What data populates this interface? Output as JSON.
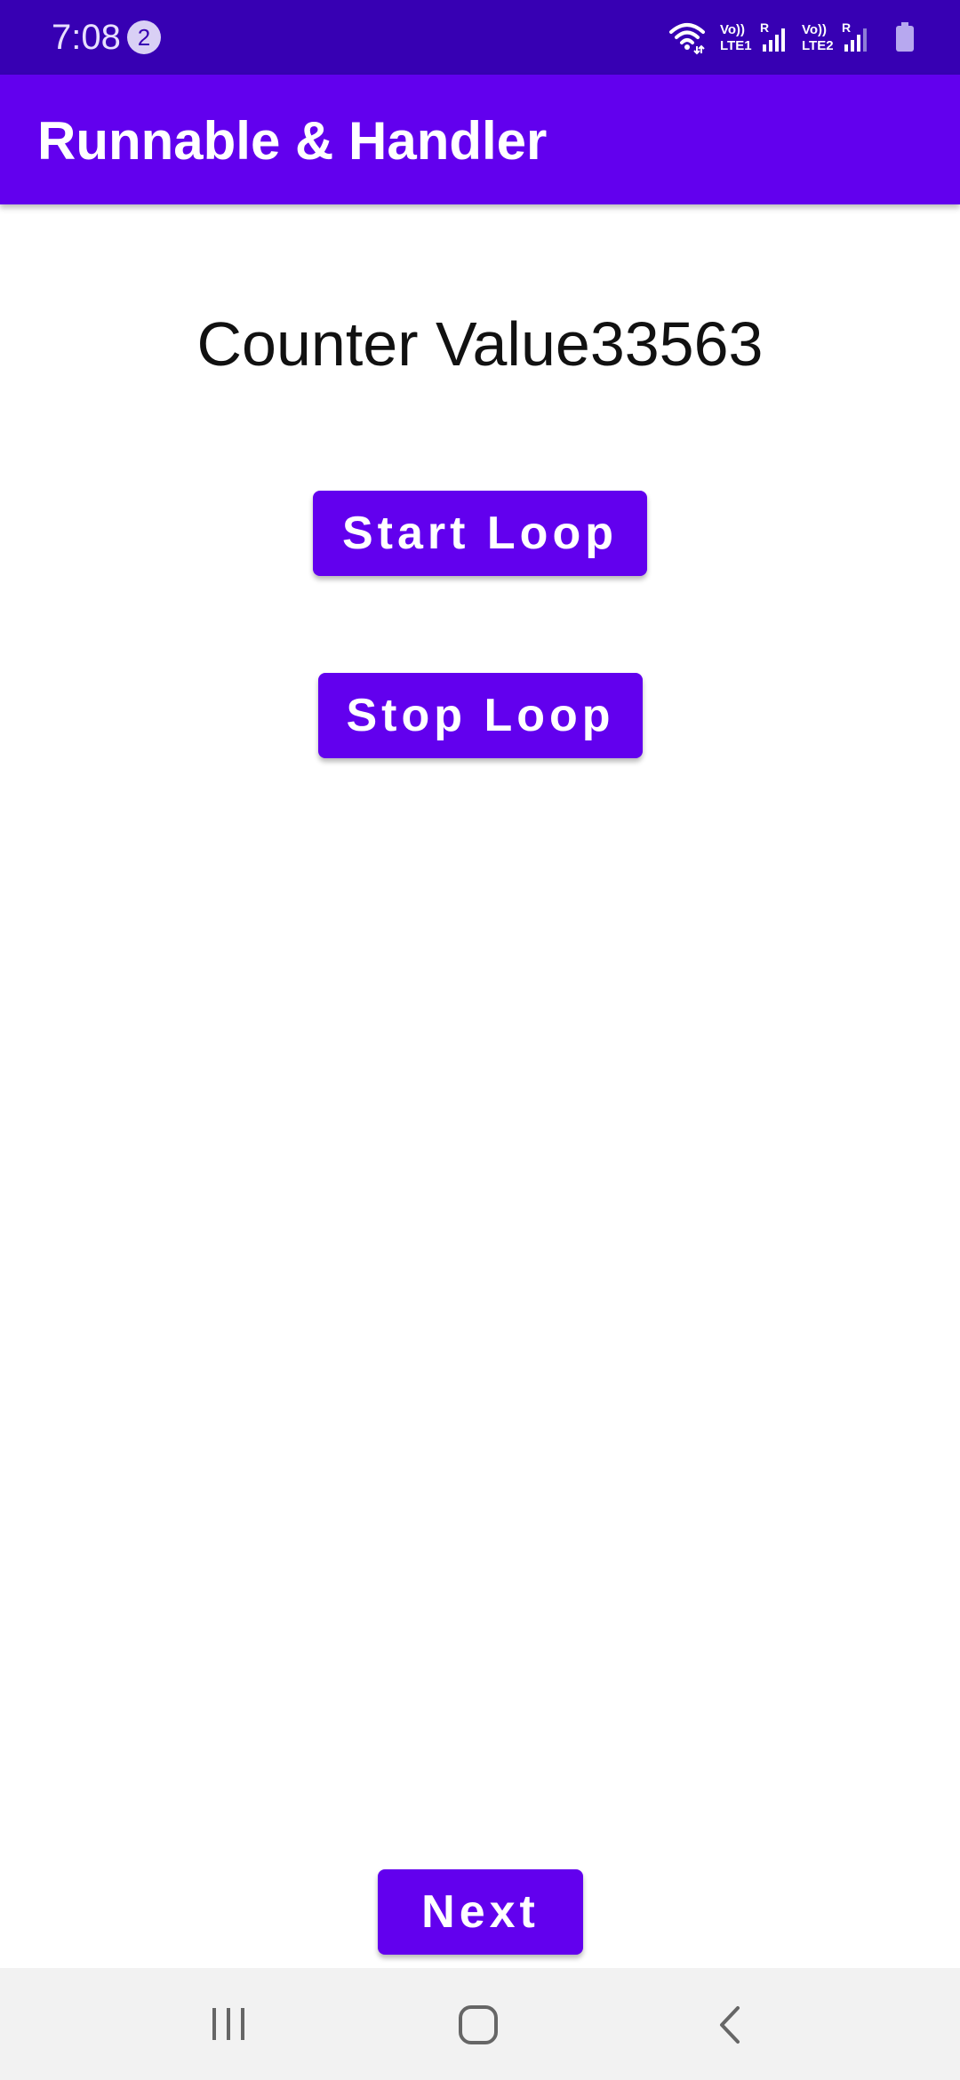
{
  "status_bar": {
    "time": "7:08",
    "notification_count": "2",
    "signal_labels": [
      "Vo)) R LTE1",
      "Vo)) R LTE2"
    ],
    "icons": [
      "wifi-icon",
      "signal-sim1-icon",
      "signal-sim2-icon",
      "battery-icon"
    ]
  },
  "app_bar": {
    "title": "Runnable & Handler"
  },
  "main": {
    "counter_text": "Counter Value33563",
    "start_button_label": "Start Loop",
    "stop_button_label": "Stop Loop",
    "next_button_label": "Next"
  },
  "nav_bar": {
    "icons": [
      "recents-icon",
      "home-icon",
      "back-icon"
    ]
  },
  "colors": {
    "status_bar": "#3700b3",
    "primary": "#6200ee",
    "background": "#ffffff",
    "nav_bar": "#f2f2f2"
  }
}
